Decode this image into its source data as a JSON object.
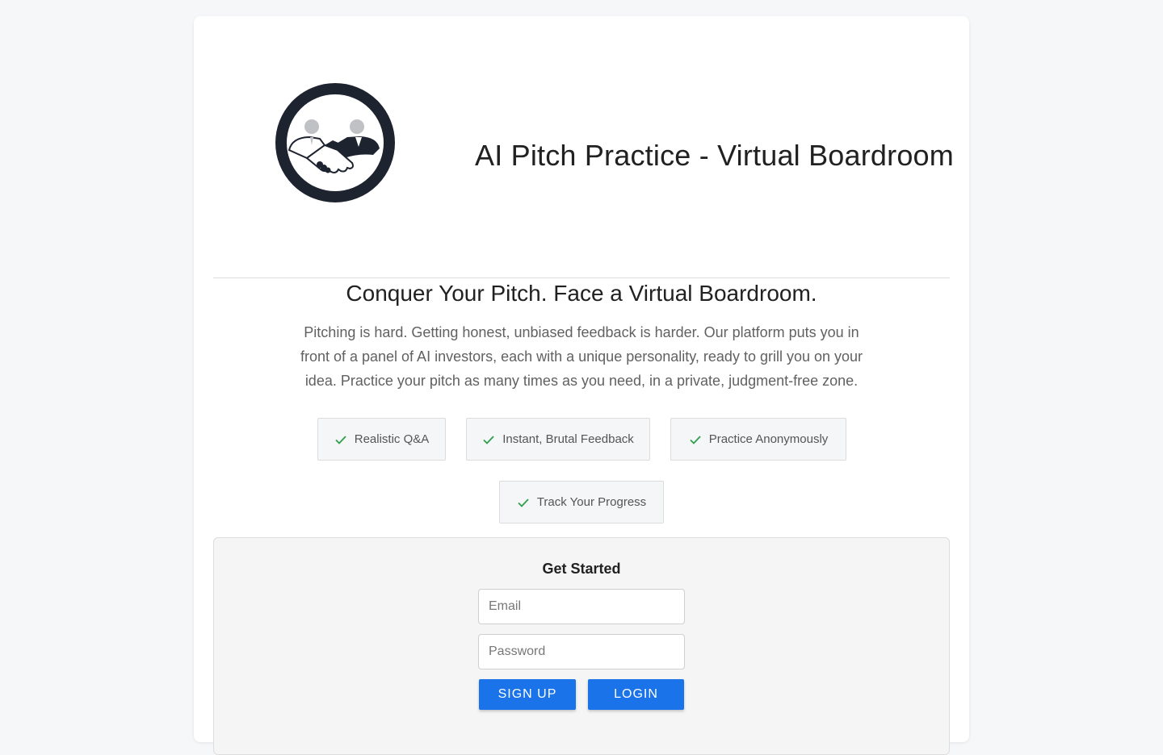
{
  "header": {
    "logo_icon": "handshake-icon",
    "title": "AI Pitch Practice - Virtual Boardroom"
  },
  "intro": {
    "headline": "Conquer Your Pitch. Face a Virtual Boardroom.",
    "description": "Pitching is hard. Getting honest, unbiased feedback is harder. Our platform puts you in front of a panel of AI investors, each with a unique personality, ready to grill you on your idea. Practice your pitch as many times as you need, in a private, judgment-free zone."
  },
  "features": [
    {
      "label": "Realistic Q&A",
      "icon": "check-icon"
    },
    {
      "label": "Instant, Brutal Feedback",
      "icon": "check-icon"
    },
    {
      "label": "Practice Anonymously",
      "icon": "check-icon"
    },
    {
      "label": "Track Your Progress",
      "icon": "check-icon"
    }
  ],
  "auth": {
    "title": "Get Started",
    "email_placeholder": "Email",
    "email_value": "",
    "password_placeholder": "Password",
    "password_value": "",
    "signup_label": "Sign Up",
    "login_label": "Login"
  },
  "colors": {
    "accent": "#1a73e8",
    "check": "#2e9e49",
    "logo_dark": "#1e2330"
  }
}
